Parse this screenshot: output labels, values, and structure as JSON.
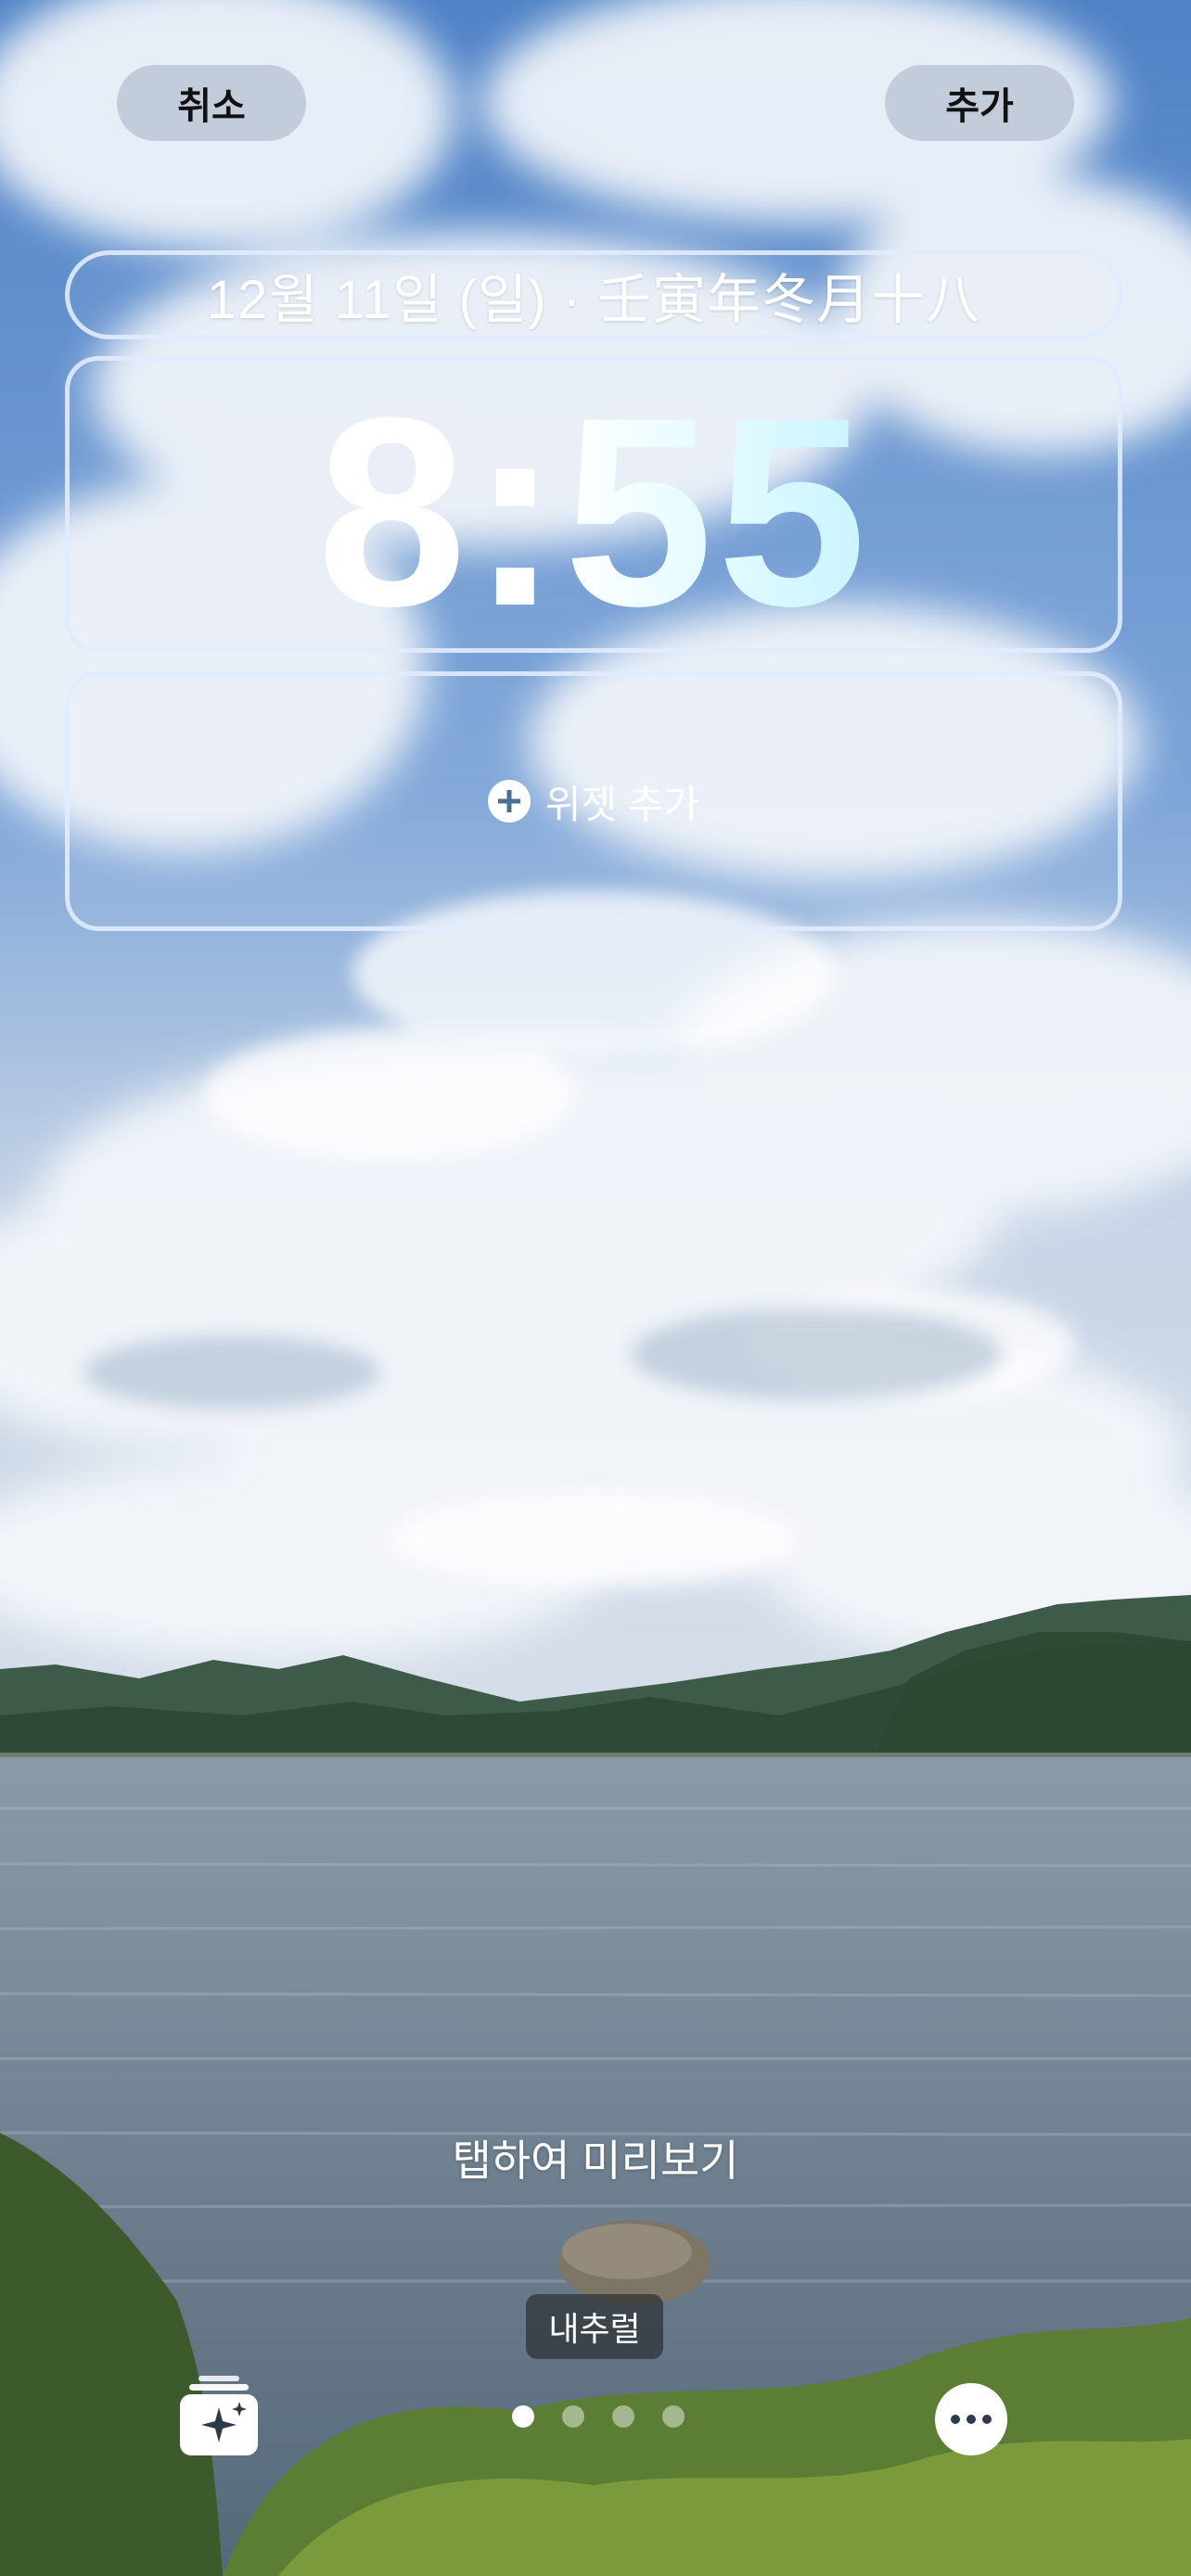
{
  "header": {
    "cancel_label": "취소",
    "add_label": "추가"
  },
  "lockscreen": {
    "date": "12월 11일 (일) · 壬寅年冬月十八",
    "time": "8:55",
    "add_widget_label": "위젯 추가"
  },
  "preview": {
    "tap_to_preview": "탭하여 미리보기",
    "filter_name": "내추럴"
  },
  "bottom_bar": {
    "gallery_icon": "photo-stack-sparkle-icon",
    "more_icon": "ellipsis-icon",
    "page_count": 4,
    "active_page": 1
  },
  "colors": {
    "sky": "#5f8fd0",
    "pill_bg": "#b9c4d4",
    "frame": "#e1ebff",
    "time_gradient_end": "#c9f4ff"
  }
}
